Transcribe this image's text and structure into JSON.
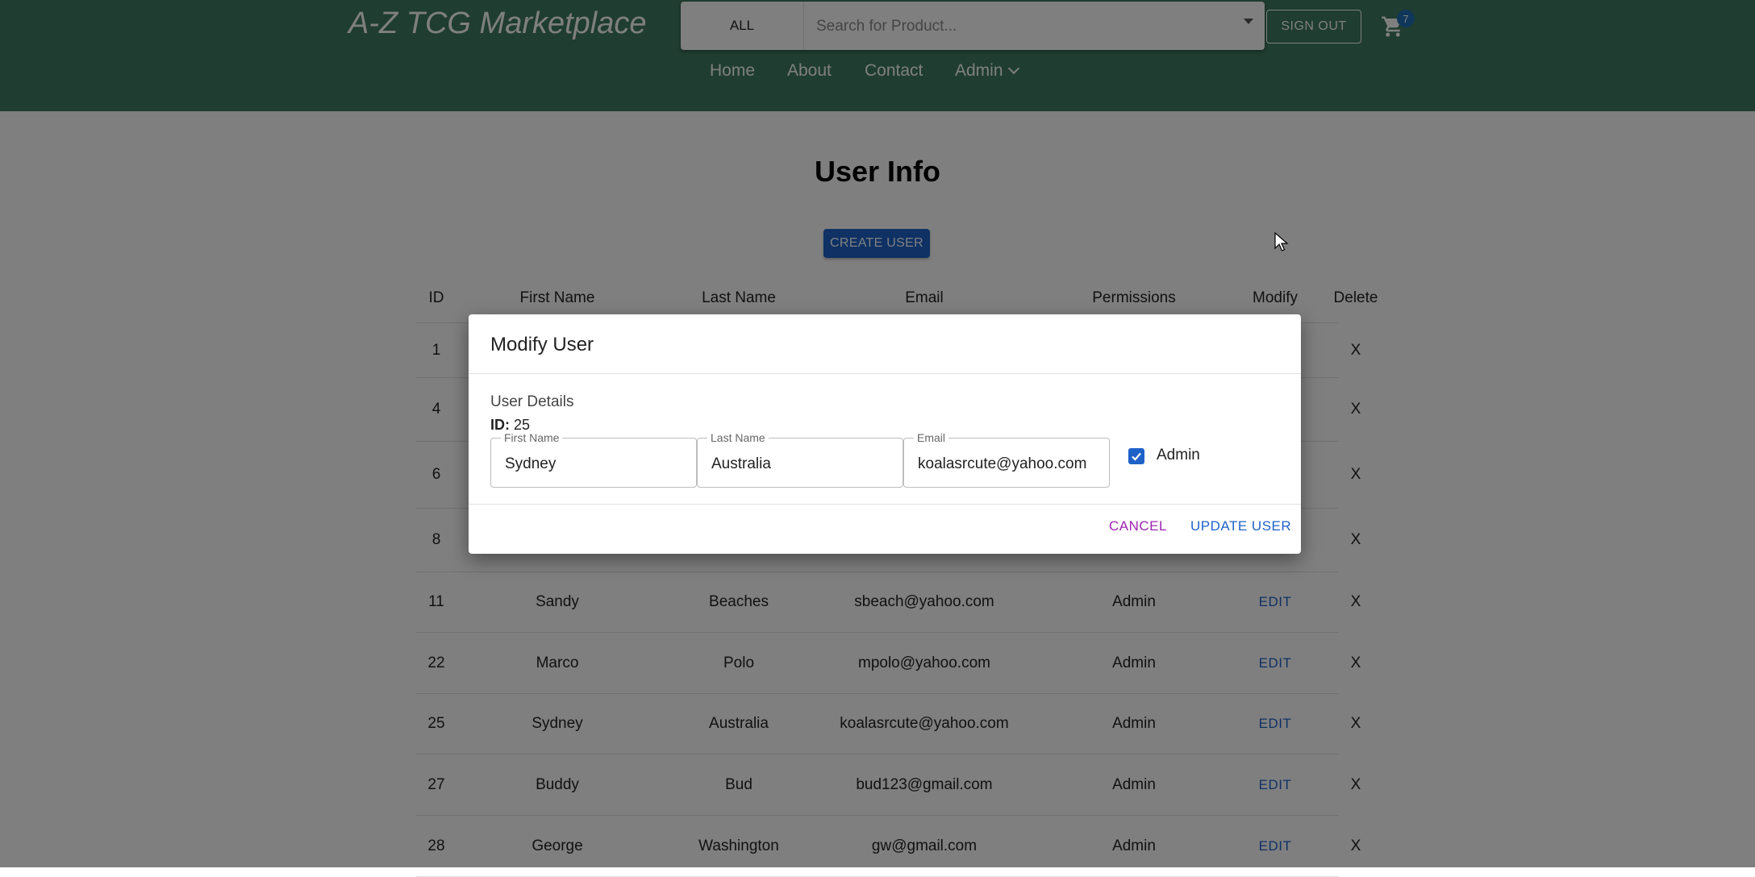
{
  "header": {
    "brand": "A-Z TCG Marketplace",
    "search": {
      "category": "ALL",
      "placeholder": "Search for Product..."
    },
    "signout_label": "SIGN OUT",
    "cart_count": "7",
    "nav": {
      "home": "Home",
      "about": "About",
      "contact": "Contact",
      "admin": "Admin"
    }
  },
  "main": {
    "title": "User Info",
    "create_label": "CREATE USER",
    "table": {
      "headers": {
        "id": "ID",
        "first": "First Name",
        "last": "Last Name",
        "email": "Email",
        "permissions": "Permissions",
        "modify": "Modify",
        "delete": "Delete"
      },
      "rows": [
        {
          "id": "1",
          "first": "",
          "last": "",
          "email": "",
          "permissions": "",
          "modify": "",
          "delete": "X"
        },
        {
          "id": "4",
          "first": "",
          "last": "",
          "email": "",
          "permissions": "",
          "modify": "",
          "delete": "X"
        },
        {
          "id": "6",
          "first": "",
          "last": "",
          "email": "",
          "permissions": "",
          "modify": "",
          "delete": "X"
        },
        {
          "id": "8",
          "first": "",
          "last": "",
          "email": "",
          "permissions": "",
          "modify": "",
          "delete": "X"
        },
        {
          "id": "11",
          "first": "Sandy",
          "last": "Beaches",
          "email": "sbeach@yahoo.com",
          "permissions": "Admin",
          "modify": "EDIT",
          "delete": "X"
        },
        {
          "id": "22",
          "first": "Marco",
          "last": "Polo",
          "email": "mpolo@yahoo.com",
          "permissions": "Admin",
          "modify": "EDIT",
          "delete": "X"
        },
        {
          "id": "25",
          "first": "Sydney",
          "last": "Australia",
          "email": "koalasrcute@yahoo.com",
          "permissions": "Admin",
          "modify": "EDIT",
          "delete": "X"
        },
        {
          "id": "27",
          "first": "Buddy",
          "last": "Bud",
          "email": "bud123@gmail.com",
          "permissions": "Admin",
          "modify": "EDIT",
          "delete": "X"
        },
        {
          "id": "28",
          "first": "George",
          "last": "Washington",
          "email": "gw@gmail.com",
          "permissions": "Admin",
          "modify": "EDIT",
          "delete": "X"
        }
      ]
    }
  },
  "dialog": {
    "title": "Modify User",
    "details_label": "User Details",
    "id_label": "ID:",
    "id_value": "25",
    "first_label": "First Name",
    "first_value": "Sydney",
    "last_label": "Last Name",
    "last_value": "Australia",
    "email_label": "Email",
    "email_value": "koalasrcute@yahoo.com",
    "admin_label": "Admin",
    "admin_checked": true,
    "cancel_label": "CANCEL",
    "update_label": "UPDATE USER"
  },
  "icons": {
    "cart": "cart-icon",
    "checkbox": "checkmark-icon",
    "cursor": "mouse-pointer-icon",
    "dropdown": "caret-down-icon"
  },
  "colors": {
    "header": "#3f7a60",
    "primary": "#1e62c8",
    "cancel": "#9c27b0",
    "badge": "#1f6fb5"
  }
}
